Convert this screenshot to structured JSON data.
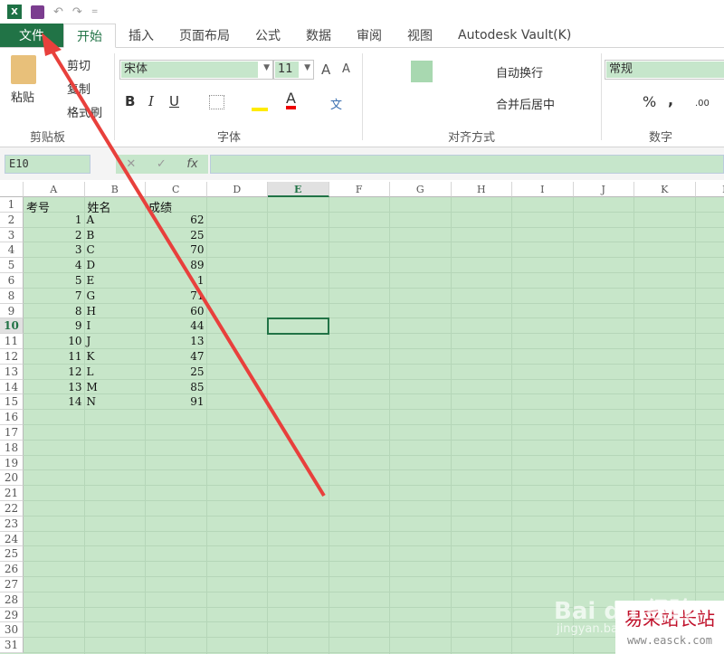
{
  "qat": {
    "excel_icon": "X",
    "undo": "↶",
    "redo": "↷",
    "customize": "="
  },
  "tabs": [
    "文件",
    "开始",
    "插入",
    "页面布局",
    "公式",
    "数据",
    "审阅",
    "视图",
    "Autodesk Vault(K)"
  ],
  "ribbon": {
    "clipboard": {
      "paste": "粘贴",
      "cut": "剪切",
      "copy": "复制",
      "format_painter": "格式刷",
      "group": "剪贴板"
    },
    "font": {
      "font_name": "宋体",
      "font_size": "11",
      "grow": "A",
      "shrink": "A",
      "bold": "B",
      "italic": "I",
      "underline": "U",
      "font_color": "A",
      "phonetic": "文",
      "group": "字体"
    },
    "alignment": {
      "wrap": "自动换行",
      "merge": "合并后居中",
      "group": "对齐方式"
    },
    "number": {
      "format": "常规",
      "percent": "%",
      "comma": ",",
      "inc_decimal": ".00",
      "group": "数字"
    }
  },
  "formula_bar": {
    "name_box": "E10",
    "cancel": "✕",
    "enter": "✓",
    "fx": "fx",
    "value": ""
  },
  "columns": [
    "A",
    "B",
    "C",
    "D",
    "E",
    "F",
    "G",
    "H",
    "I",
    "J",
    "K",
    "L"
  ],
  "rows": [
    "1",
    "2",
    "3",
    "4",
    "5",
    "6",
    "8",
    "9",
    "10",
    "11",
    "12",
    "13",
    "14",
    "15",
    "16",
    "17",
    "18",
    "19",
    "20",
    "21",
    "22",
    "23",
    "24",
    "25",
    "26",
    "27",
    "28",
    "29",
    "30",
    "31"
  ],
  "table": {
    "headers": [
      "考号",
      "姓名",
      "成绩"
    ],
    "data": [
      [
        "1",
        "A",
        "62"
      ],
      [
        "2",
        "B",
        "25"
      ],
      [
        "3",
        "C",
        "70"
      ],
      [
        "4",
        "D",
        "89"
      ],
      [
        "5",
        "E",
        "1"
      ],
      [
        "7",
        "G",
        "71"
      ],
      [
        "8",
        "H",
        "60"
      ],
      [
        "9",
        "I",
        "44"
      ],
      [
        "10",
        "J",
        "13"
      ],
      [
        "11",
        "K",
        "47"
      ],
      [
        "12",
        "L",
        "25"
      ],
      [
        "13",
        "M",
        "85"
      ],
      [
        "14",
        "N",
        "91"
      ]
    ]
  },
  "watermark": {
    "baidu": "Bai du 经验",
    "baidu_sub": "jingyan.baidu.com",
    "site": "易采站长站",
    "url": "www.easck.com"
  },
  "colors": {
    "accent": "#217346",
    "sheet_bg": "#c7e6c9",
    "arrow": "#e8403c"
  }
}
